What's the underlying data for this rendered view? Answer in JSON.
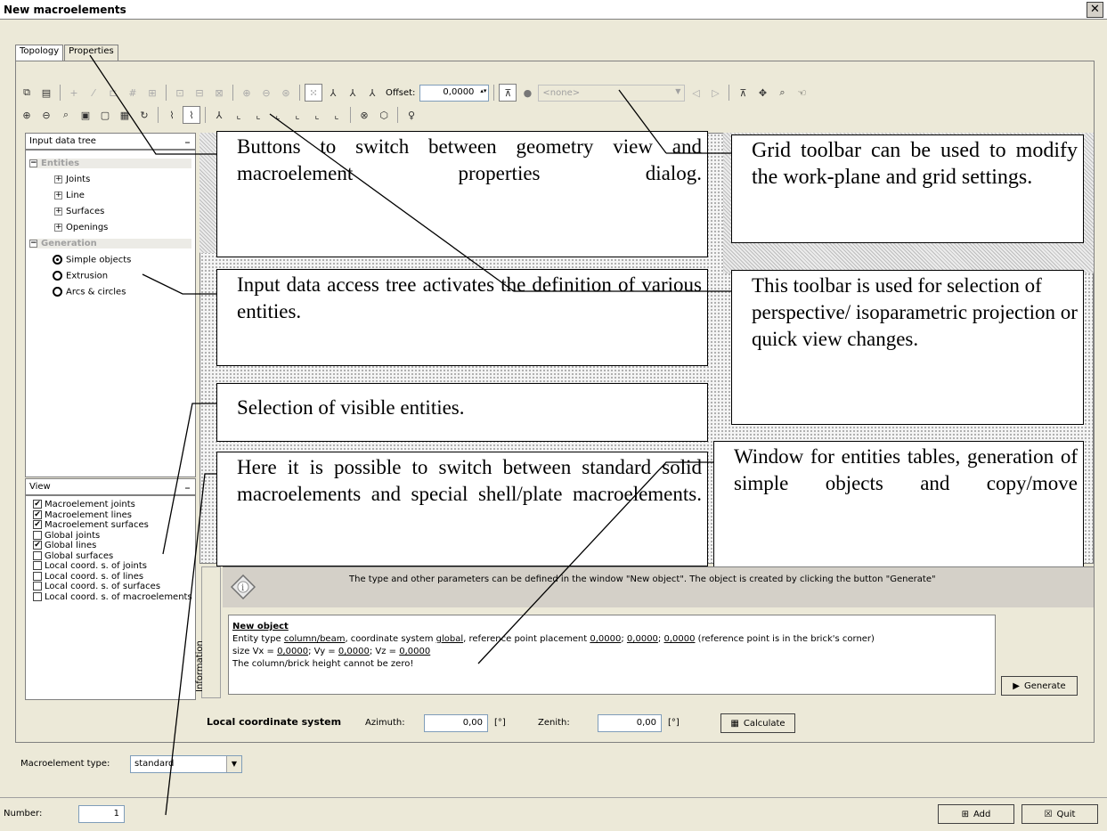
{
  "window": {
    "title": "New macroelements",
    "close_symbol": "✕"
  },
  "tabs": [
    {
      "label": "Topology"
    },
    {
      "label": "Properties"
    }
  ],
  "toolbar": {
    "offset_label": "Offset:",
    "offset_value": "0,0000",
    "work_plane_combo": "<none>"
  },
  "input_tree": {
    "header": "Input data tree",
    "entities_label": "Entities",
    "entities": [
      "Joints",
      "Line",
      "Surfaces",
      "Openings"
    ],
    "generation_label": "Generation",
    "generation": [
      "Simple objects",
      "Extrusion",
      "Arcs & circles"
    ],
    "selected_generation": "Simple objects"
  },
  "view_panel": {
    "header": "View",
    "items": [
      {
        "label": "Macroelement joints",
        "checked": true
      },
      {
        "label": "Macroelement lines",
        "checked": true
      },
      {
        "label": "Macroelement surfaces",
        "checked": true
      },
      {
        "label": "Global joints",
        "checked": false
      },
      {
        "label": "Global lines",
        "checked": true
      },
      {
        "label": "Global surfaces",
        "checked": false
      },
      {
        "label": "Local coord. s. of joints",
        "checked": false
      },
      {
        "label": "Local coord. s. of lines",
        "checked": false
      },
      {
        "label": "Local coord. s. of surfaces",
        "checked": false
      },
      {
        "label": "Local coord. s. of macroelements",
        "checked": false
      }
    ]
  },
  "callouts": {
    "tabs": "Buttons to switch between geometry view and macroelement properties dialog.",
    "grid": "Grid toolbar can be used to modify the work-plane and grid settings.",
    "tree": "Input data access tree activates the definition of various entities.",
    "projection": "This toolbar is used for selection of perspective/ isoparametric projection or quick view changes.",
    "visible": "Selection of visible entities.",
    "type": "Here it is possible to switch between standard solid macroelements and special shell/plate macroelements.",
    "window": "Window for entities tables, generation of simple objects and copy/move"
  },
  "information": {
    "tab_label": "Information",
    "hint": "The type and other parameters can be defined in the window \"New object\". The object is created by clicking the button \"Generate\"",
    "object_title": "New object",
    "line1_pre": "Entity type ",
    "entity_type": "column/beam",
    "line1_mid": ", coordinate system ",
    "coord_system": "global",
    "line1_mid2": ", reference point placement ",
    "ref_x": "0,0000",
    "ref_y": "0,0000",
    "ref_z": "0,0000",
    "line1_post": " (reference point is in the brick's corner)",
    "size_pre": "size  Vx = ",
    "vx": "0,0000",
    "vy_label": "; Vy = ",
    "vy": "0,0000",
    "vz_label": "; Vz = ",
    "vz": "0,0000",
    "warning": "The column/brick height cannot be zero!",
    "generate_label": "Generate"
  },
  "local_coords": {
    "label": "Local coordinate system",
    "azimuth_label": "Azimuth:",
    "azimuth_value": "0,00",
    "zenith_label": "Zenith:",
    "zenith_value": "0,00",
    "unit": "[°]",
    "calculate_label": "Calculate"
  },
  "macro_type": {
    "label": "Macroelement type:",
    "value": "standard"
  },
  "footer": {
    "number_label": "Number:",
    "number_value": "1",
    "add_label": "Add",
    "quit_label": "Quit"
  }
}
